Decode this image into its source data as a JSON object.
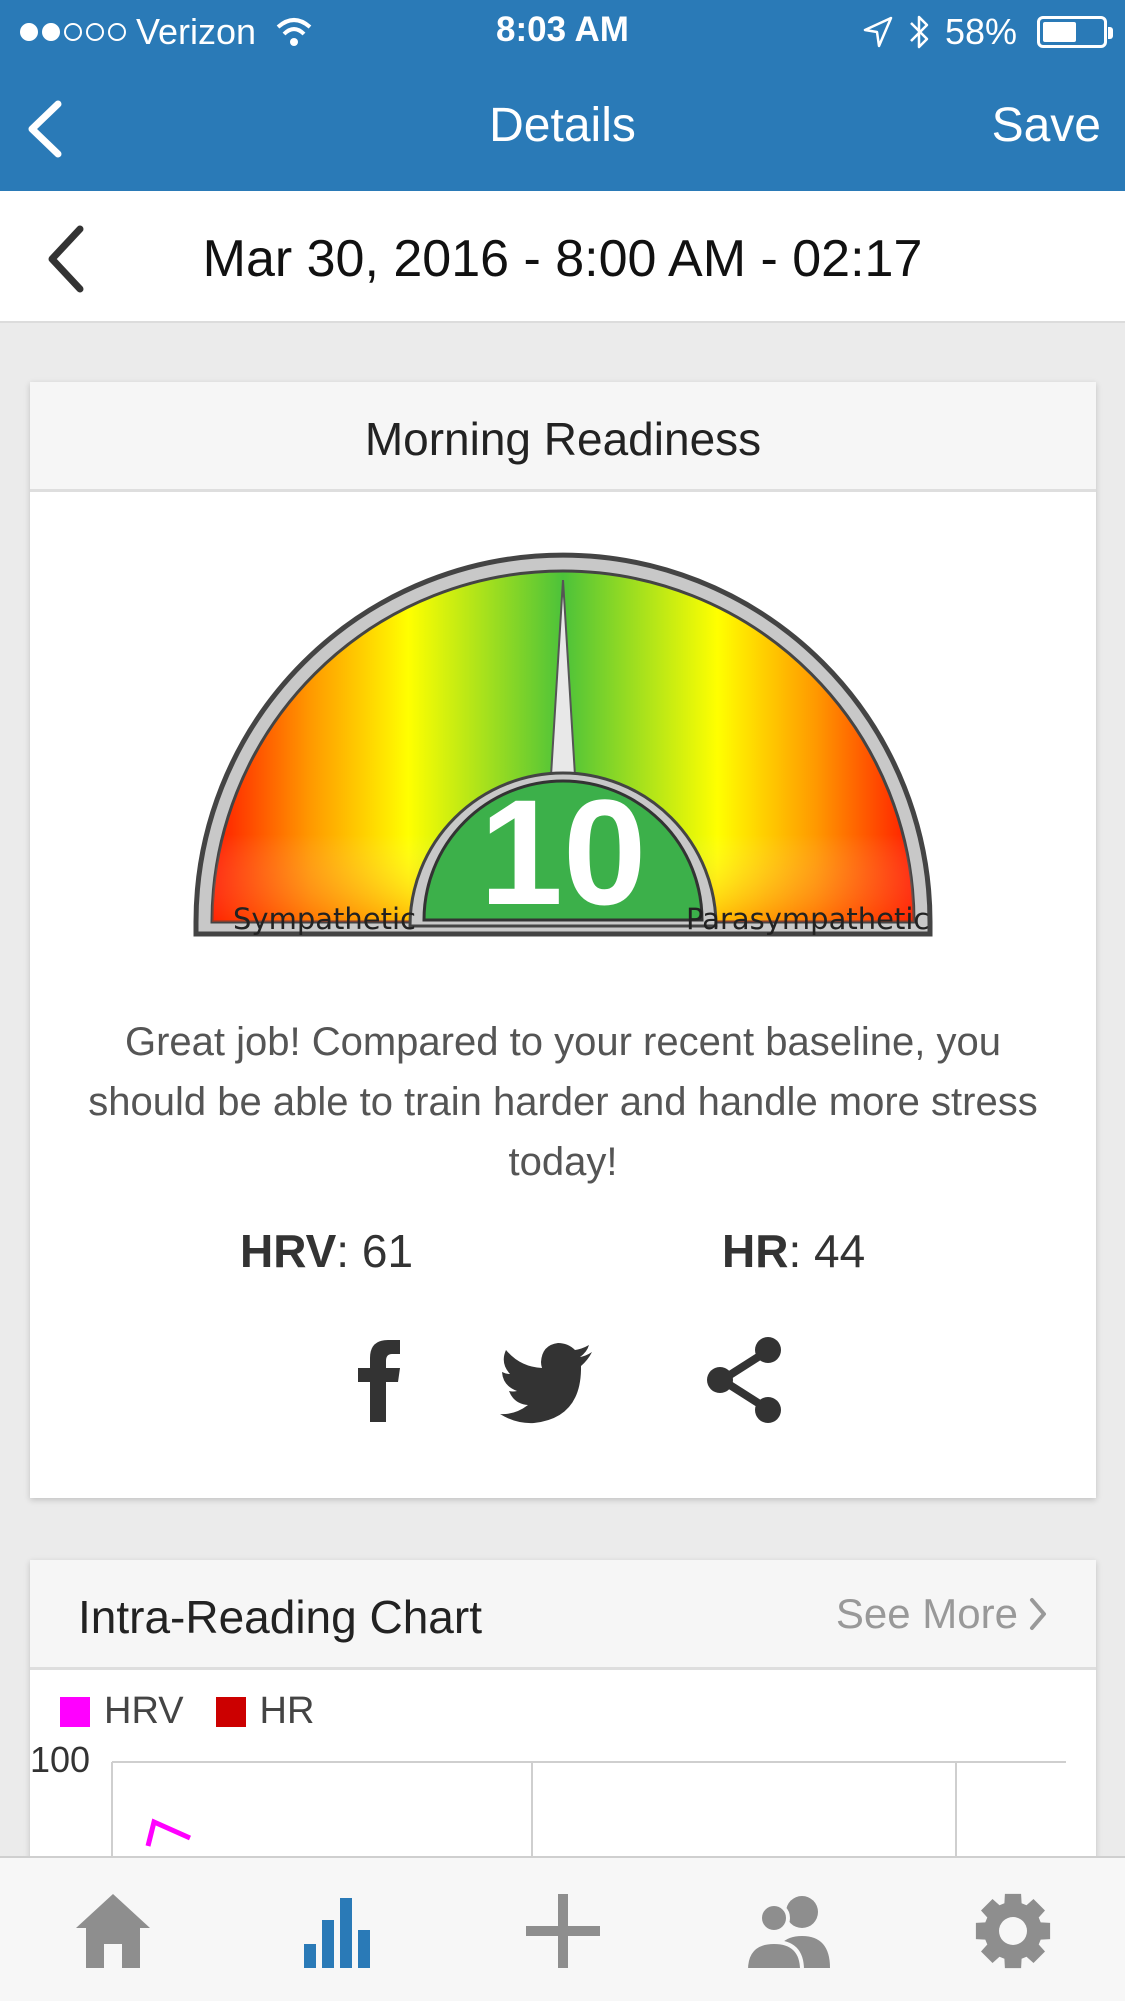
{
  "status": {
    "carrier": "Verizon",
    "time": "8:03 AM",
    "battery": "58%",
    "battery_level": 0.58
  },
  "nav": {
    "title": "Details",
    "save_label": "Save",
    "back_icon": "chevron-left-icon"
  },
  "reading": {
    "date": "Mar 30, 2016 - 8:00 AM - 02:17",
    "prev_icon": "chevron-left-icon"
  },
  "readiness": {
    "title": "Morning Readiness",
    "score": "10",
    "left_label": "Sympathetic",
    "right_label": "Parasympathetic",
    "message": "Great job! Compared to your recent baseline, you should be able to train harder and handle more stress today!",
    "hrv_label": "HRV",
    "hrv_value": ": 61",
    "hr_label": "HR",
    "hr_value": ": 44",
    "share_icons": [
      "facebook-icon",
      "twitter-icon",
      "share-icon"
    ]
  },
  "intra_chart": {
    "title": "Intra-Reading Chart",
    "see_more": "See More",
    "legend": [
      {
        "name": "HRV",
        "color": "#ff00ff"
      },
      {
        "name": "HR",
        "color": "#cc0000"
      }
    ],
    "y_tick": "100"
  },
  "tabs": [
    {
      "name": "home",
      "icon": "home-icon",
      "color": "#8e8e8e"
    },
    {
      "name": "stats",
      "icon": "bar-chart-icon",
      "color": "#2a7ab7"
    },
    {
      "name": "add",
      "icon": "plus-icon",
      "color": "#8e8e8e"
    },
    {
      "name": "team",
      "icon": "users-icon",
      "color": "#8e8e8e"
    },
    {
      "name": "settings",
      "icon": "gear-icon",
      "color": "#8e8e8e"
    }
  ],
  "colors": {
    "brand": "#2a7ab7",
    "gauge_center": "#3cb04a"
  }
}
